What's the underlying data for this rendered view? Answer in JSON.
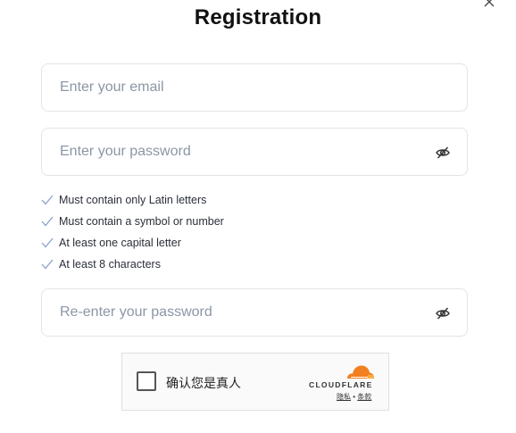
{
  "modal": {
    "title": "Registration",
    "close_icon": "close-icon"
  },
  "email": {
    "placeholder": "Enter your email",
    "value": ""
  },
  "password": {
    "placeholder": "Enter your password",
    "value": "",
    "toggle_icon": "eye-off-icon"
  },
  "password_rules": [
    {
      "label": "Must contain only Latin letters",
      "icon": "check-icon"
    },
    {
      "label": "Must contain a symbol or number",
      "icon": "check-icon"
    },
    {
      "label": "At least one capital letter",
      "icon": "check-icon"
    },
    {
      "label": "At least 8 characters",
      "icon": "check-icon"
    }
  ],
  "confirm_password": {
    "placeholder": "Re-enter your password",
    "value": "",
    "toggle_icon": "eye-off-icon"
  },
  "captcha": {
    "checkbox_label": "确认您是真人",
    "brand": "CLOUDFLARE",
    "privacy_link": "隐私",
    "separator": "•",
    "terms_link": "条款",
    "logo_color": "#f38020"
  },
  "colors": {
    "check": "#8aa2c8",
    "placeholder": "#8b96a6",
    "border": "#e2e4ea"
  }
}
